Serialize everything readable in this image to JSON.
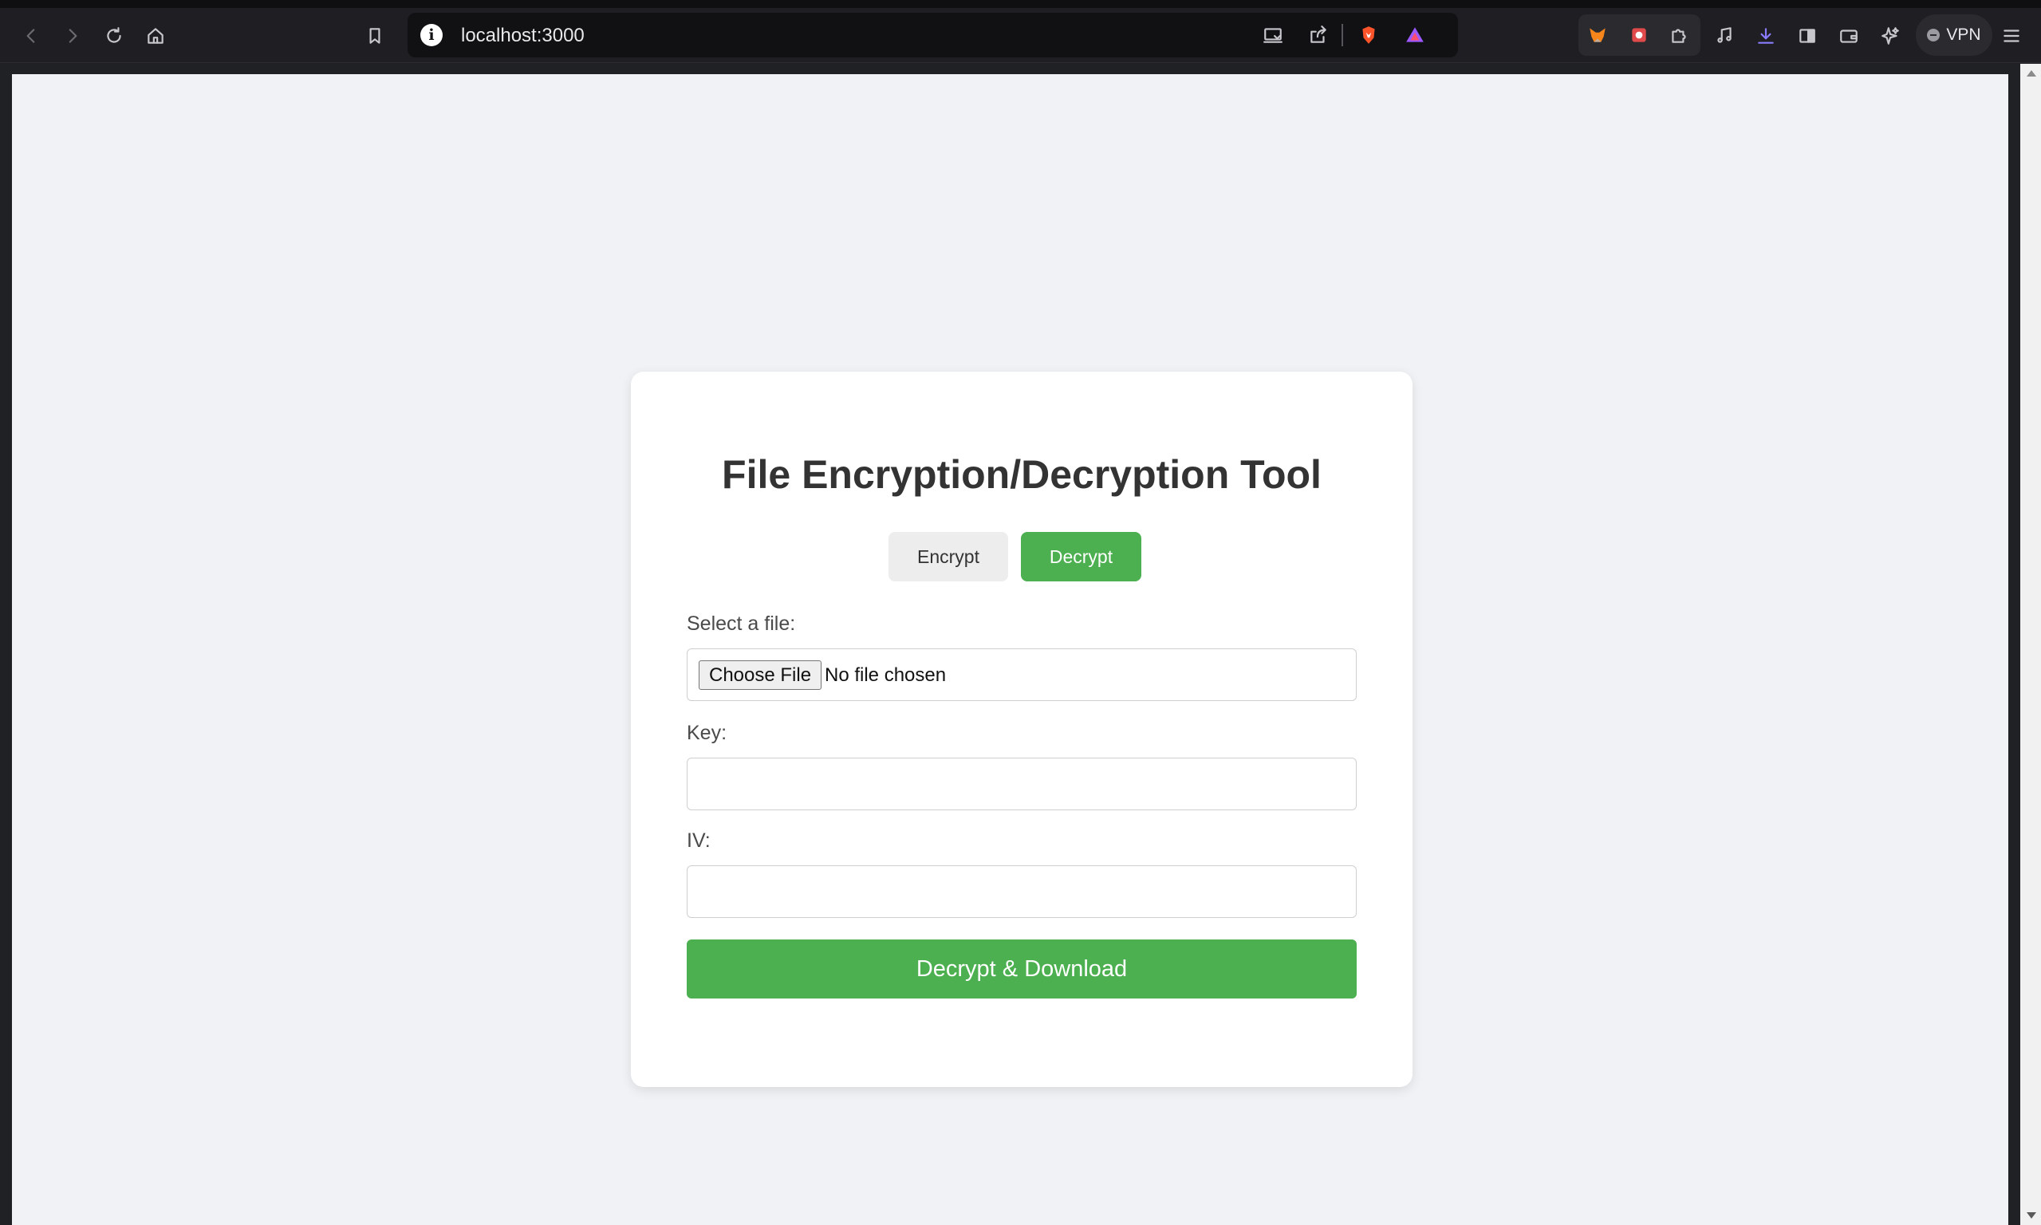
{
  "browser": {
    "url": "localhost:3000",
    "vpn_label": "VPN"
  },
  "app": {
    "title": "File Encryption/Decryption Tool",
    "modes": {
      "encrypt_label": "Encrypt",
      "decrypt_label": "Decrypt",
      "active": "Decrypt"
    },
    "file": {
      "label": "Select a file:",
      "button_label": "Choose File",
      "status": "No file chosen"
    },
    "key": {
      "label": "Key:",
      "value": ""
    },
    "iv": {
      "label": "IV:",
      "value": ""
    },
    "submit_label": "Decrypt & Download"
  },
  "colors": {
    "accent": "#4caf50",
    "page_background": "#f0f2f5",
    "title": "#333333"
  }
}
